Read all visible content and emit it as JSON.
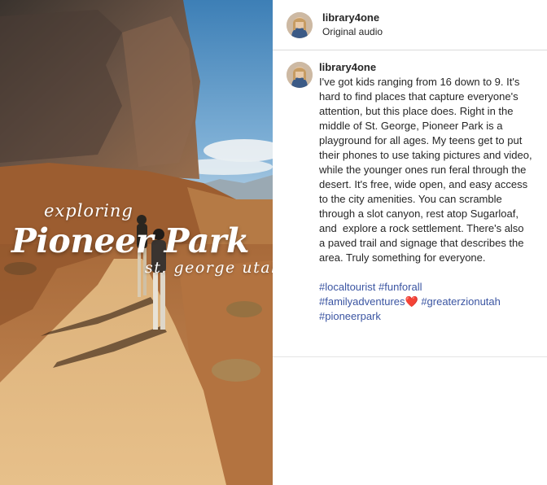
{
  "post": {
    "overlay": {
      "small": "exploring",
      "title": "Pioneer Park",
      "subtitle": "st. george utah"
    }
  },
  "header": {
    "username": "library4one",
    "audio": "Original audio"
  },
  "caption": {
    "username": "library4one",
    "text": "I've got kids ranging from 16 down to 9. It's hard to find places that capture everyone's attention, but this place does. Right in the middle of St. George, Pioneer Park is a playground for all ages. My teens get to put their phones to use taking pictures and video, while the younger ones run feral through the desert. It's free, wide open, and easy access to the city amenities. You can scramble through a slot canyon, rest atop Sugarloaf, and  explore a rock settlement. There's also a paved trail and signage that describes the area. Truly something for everyone.",
    "hashtags": {
      "t1": "#localtourist",
      "t2": "#funforall",
      "t3": "#familyadventures",
      "heart": "❤️",
      "t4": "#greaterzionutah",
      "t5": "#pioneerpark"
    }
  },
  "colors": {
    "hashtag": "#3b55a2",
    "divider": "#dbdbdb",
    "heart": "#e8364f"
  }
}
